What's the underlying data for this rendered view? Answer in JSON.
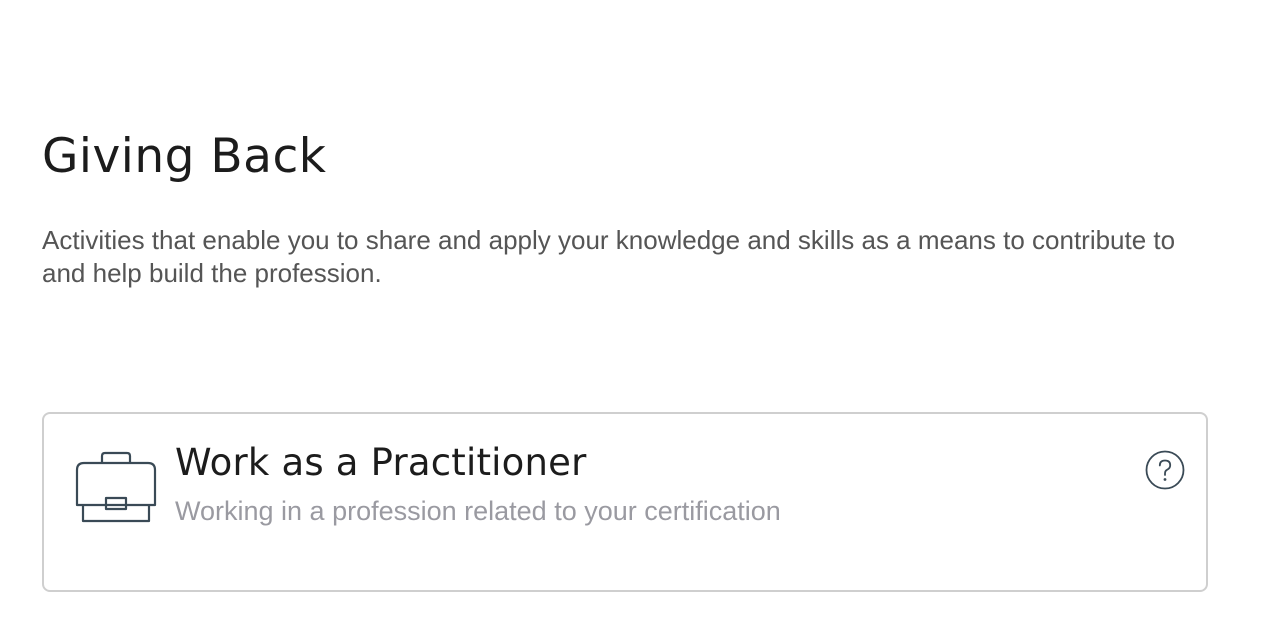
{
  "section": {
    "title": "Giving Back",
    "description": "Activities that enable you to share and apply your knowledge and skills as a means to contribute to and help build the profession."
  },
  "card": {
    "icon": "briefcase-icon",
    "title": "Work as a Practitioner",
    "subtitle": "Working in a profession related to your certification",
    "help_icon": "question-circle-icon"
  },
  "colors": {
    "title": "#1c1c1c",
    "description": "#555555",
    "subtitle": "#9a9aa1",
    "card_border": "#cfcfcf",
    "icon_stroke": "#3a4a56"
  }
}
